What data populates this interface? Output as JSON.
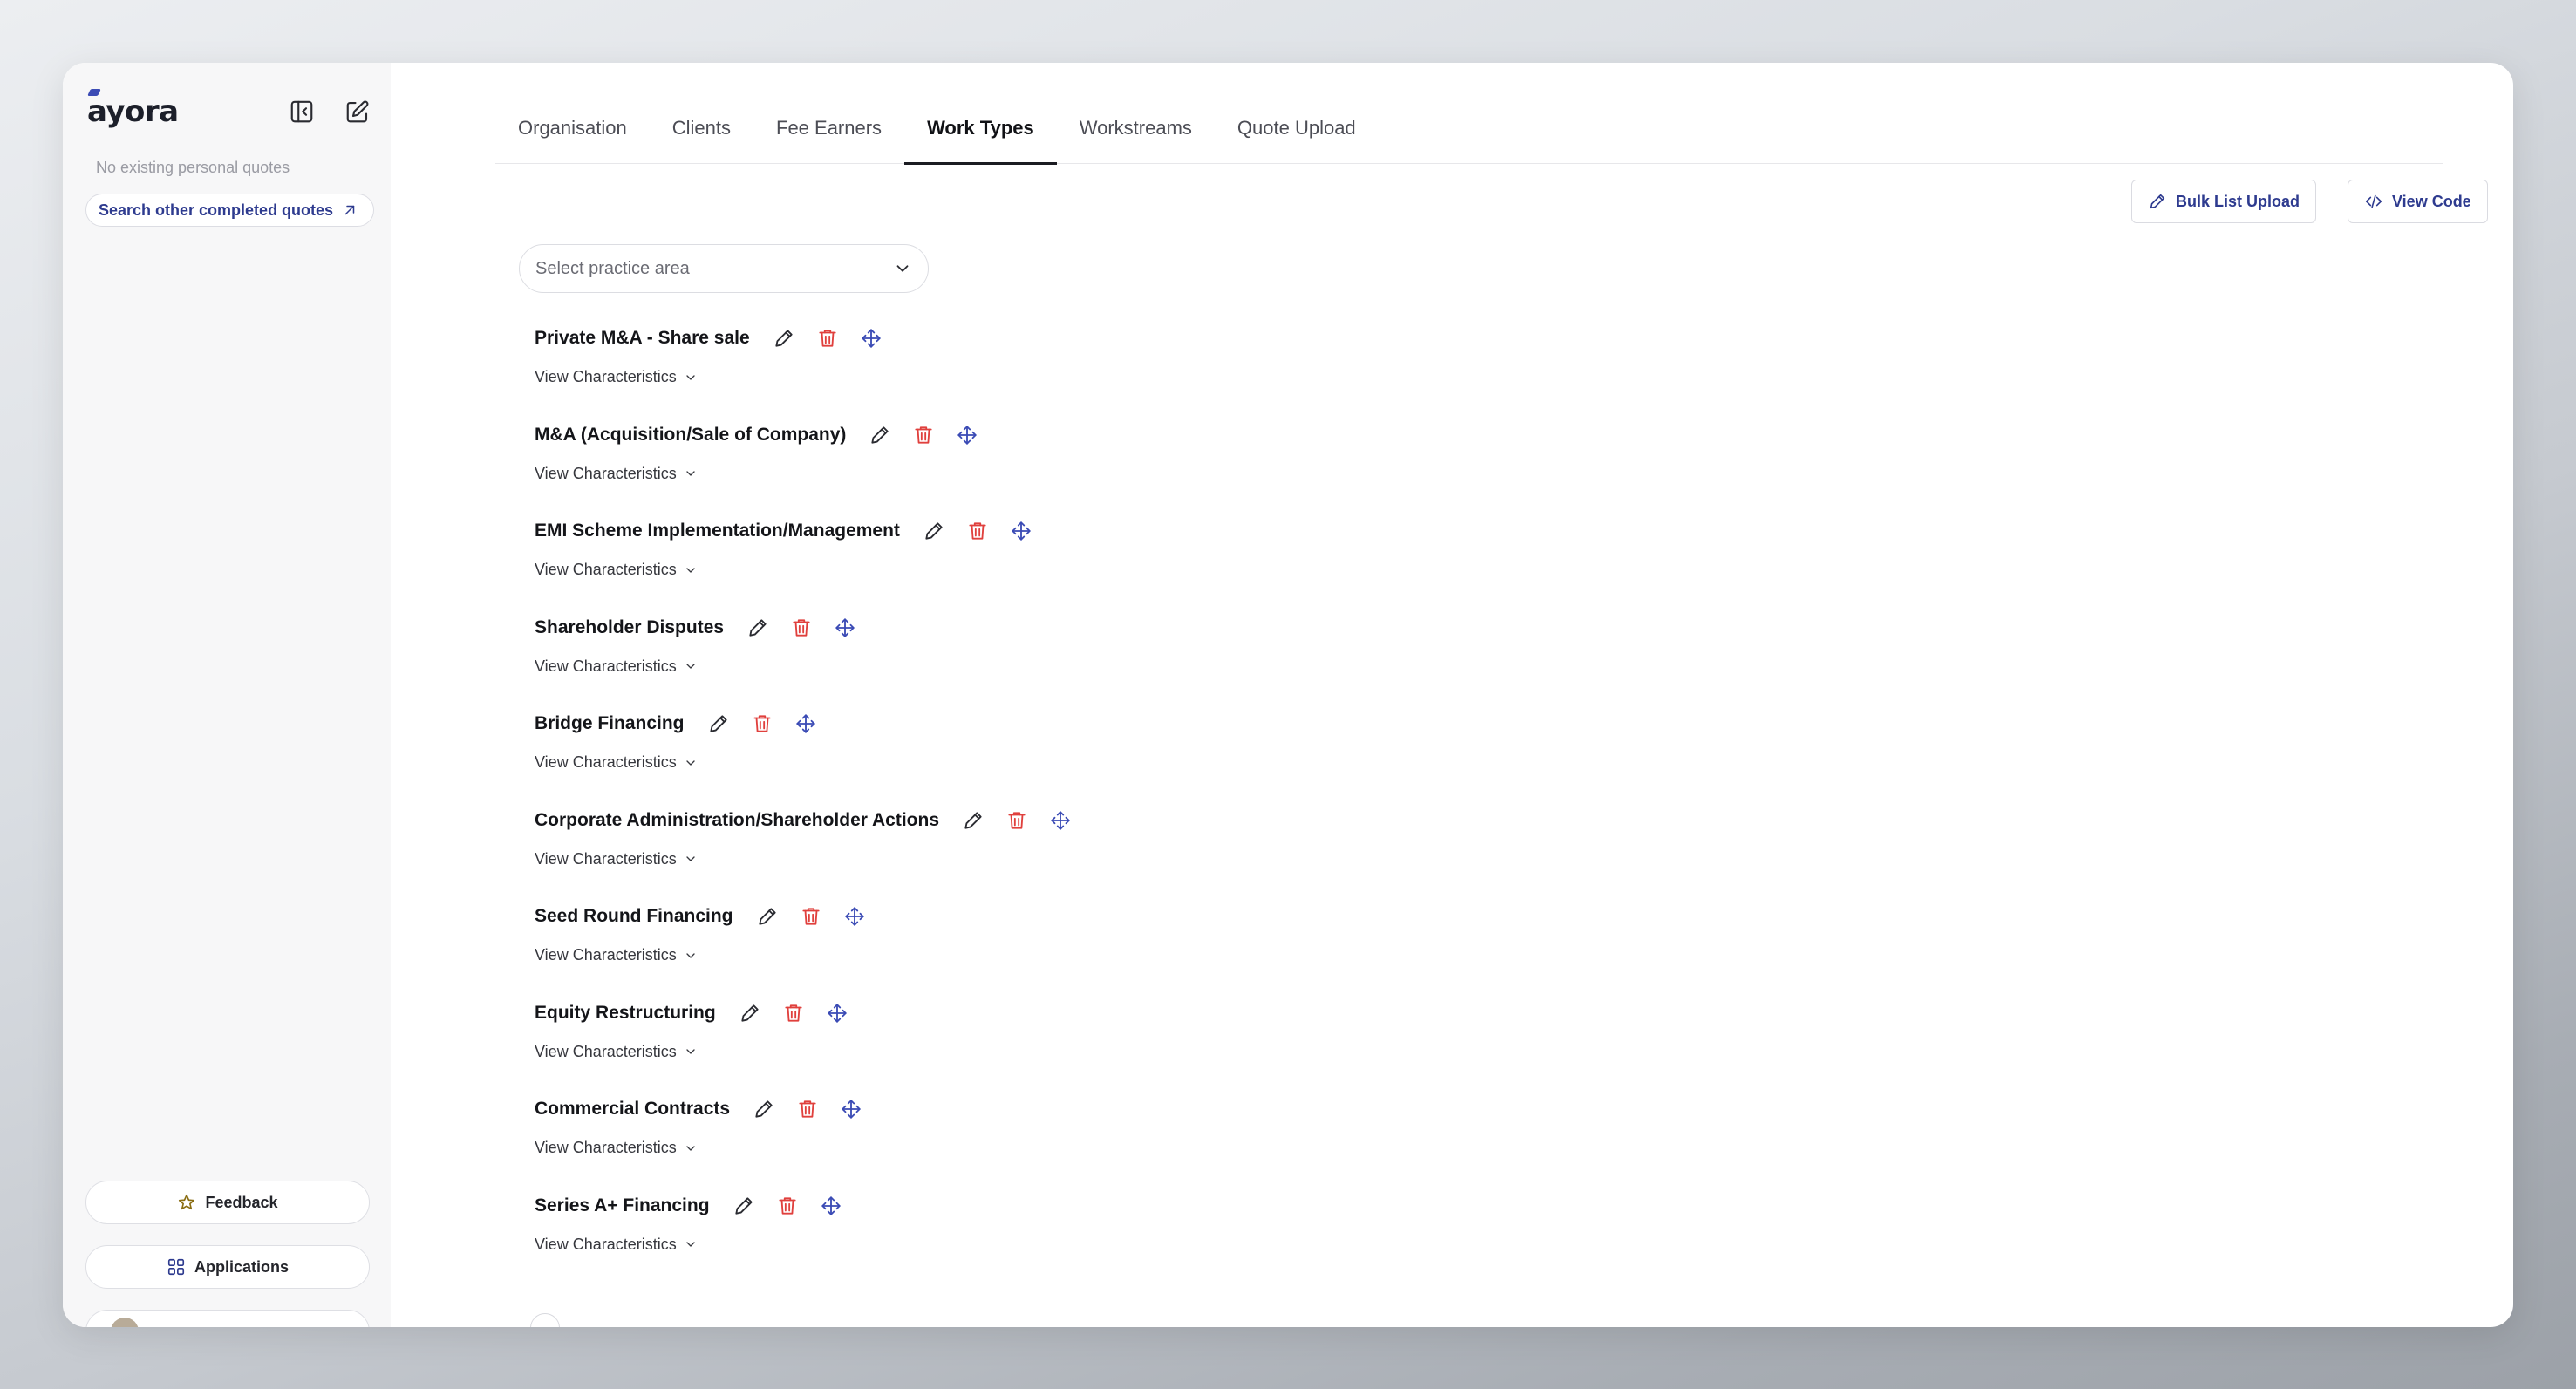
{
  "colors": {
    "accent": "#2e3b8f",
    "delete": "#e0403d",
    "move": "#3b4bb5",
    "sidebar_bg": "#f7f7f8"
  },
  "sidebar": {
    "logo": "ayora",
    "collapse_icon": "sidebar-collapse-icon",
    "new_icon": "compose-icon",
    "empty_text": "No existing personal quotes",
    "search_link": "Search other completed quotes",
    "feedback_label": "Feedback",
    "applications_label": "Applications"
  },
  "tabs": [
    {
      "label": "Organisation",
      "active": false
    },
    {
      "label": "Clients",
      "active": false
    },
    {
      "label": "Fee Earners",
      "active": false
    },
    {
      "label": "Work Types",
      "active": true
    },
    {
      "label": "Workstreams",
      "active": false
    },
    {
      "label": "Quote Upload",
      "active": false
    }
  ],
  "toolbar": {
    "bulk_upload_label": "Bulk List Upload",
    "view_code_label": "View Code"
  },
  "practice_select": {
    "placeholder": "Select practice area"
  },
  "view_characteristics_label": "View Characteristics",
  "work_types": [
    {
      "name": "Private M&A - Share sale"
    },
    {
      "name": "M&A (Acquisition/Sale of Company)"
    },
    {
      "name": "EMI Scheme Implementation/Management"
    },
    {
      "name": "Shareholder Disputes"
    },
    {
      "name": "Bridge Financing"
    },
    {
      "name": "Corporate Administration/Shareholder Actions"
    },
    {
      "name": "Seed Round Financing"
    },
    {
      "name": "Equity Restructuring"
    },
    {
      "name": "Commercial Contracts"
    },
    {
      "name": "Series A+ Financing"
    }
  ]
}
